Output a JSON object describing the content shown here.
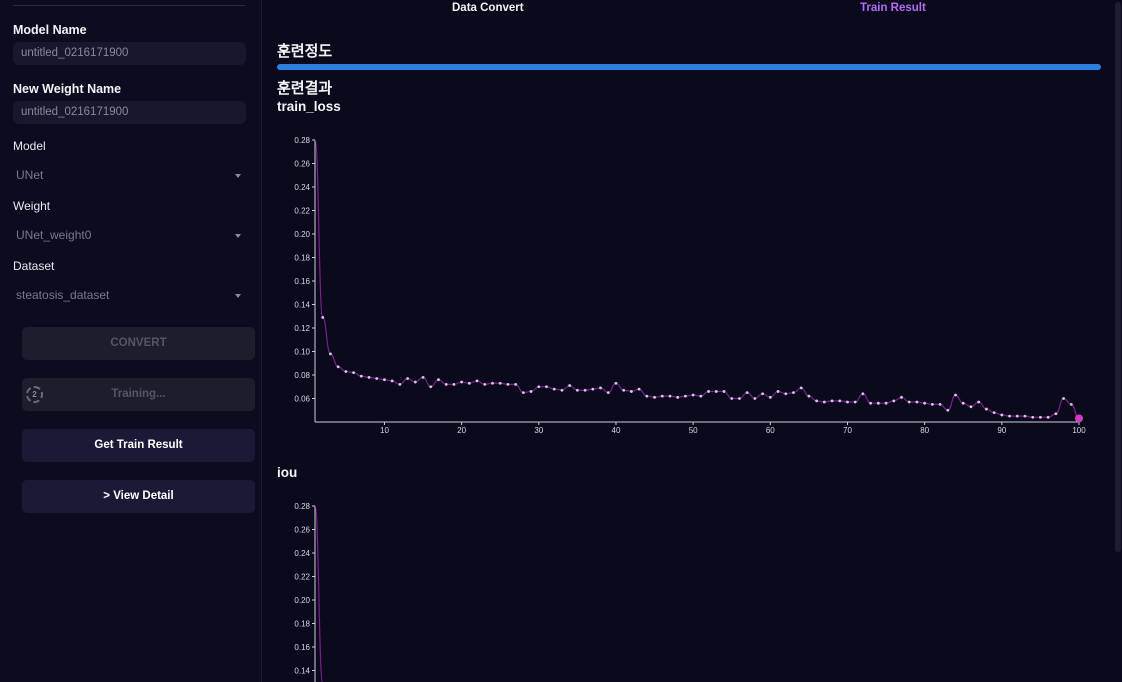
{
  "sidebar": {
    "model_name_label": "Model Name",
    "model_name_value": "untitled_0216171900",
    "weight_name_label": "New Weight Name",
    "weight_name_value": "untitled_0216171900",
    "model_label": "Model",
    "model_value": "UNet",
    "weight_label": "Weight",
    "weight_value": "UNet_weight0",
    "dataset_label": "Dataset",
    "dataset_value": "steatosis_dataset",
    "convert_button": "CONVERT",
    "training_button": "Training...",
    "spinner_text": "2",
    "train_result_button": "Get Train Result",
    "view_detail_button": "> View Detail"
  },
  "tabs": {
    "data_convert": "Data Convert",
    "train_result": "Train Result"
  },
  "main": {
    "progress_title": "훈련정도",
    "progress_value": 1.0,
    "result_title": "훈련결과"
  },
  "colors": {
    "accent": "#b46cf5",
    "progress": "#2f7fe0",
    "line": "#7a1f8e",
    "point": "#d9c6e6",
    "highlight": "#d03cc8"
  },
  "chart_data": [
    {
      "type": "line",
      "title": "train_loss",
      "ylim": [
        0.04,
        0.28
      ],
      "yticks": [
        0.06,
        0.08,
        0.1,
        0.12,
        0.14,
        0.16,
        0.18,
        0.2,
        0.22,
        0.24,
        0.26,
        0.28
      ],
      "xlim": [
        1,
        100
      ],
      "xticks": [
        10,
        20,
        30,
        40,
        50,
        60,
        70,
        80,
        90,
        100
      ],
      "x": [
        1,
        2,
        3,
        4,
        5,
        6,
        7,
        8,
        9,
        10,
        11,
        12,
        13,
        14,
        15,
        16,
        17,
        18,
        19,
        20,
        21,
        22,
        23,
        24,
        25,
        26,
        27,
        28,
        29,
        30,
        31,
        32,
        33,
        34,
        35,
        36,
        37,
        38,
        39,
        40,
        41,
        42,
        43,
        44,
        45,
        46,
        47,
        48,
        49,
        50,
        51,
        52,
        53,
        54,
        55,
        56,
        57,
        58,
        59,
        60,
        61,
        62,
        63,
        64,
        65,
        66,
        67,
        68,
        69,
        70,
        71,
        72,
        73,
        74,
        75,
        76,
        77,
        78,
        79,
        80,
        81,
        82,
        83,
        84,
        85,
        86,
        87,
        88,
        89,
        90,
        91,
        92,
        93,
        94,
        95,
        96,
        97,
        98,
        99,
        100
      ],
      "values": [
        0.28,
        0.129,
        0.098,
        0.087,
        0.083,
        0.082,
        0.079,
        0.078,
        0.077,
        0.076,
        0.075,
        0.072,
        0.077,
        0.074,
        0.078,
        0.07,
        0.076,
        0.072,
        0.072,
        0.074,
        0.073,
        0.075,
        0.072,
        0.073,
        0.073,
        0.072,
        0.072,
        0.065,
        0.066,
        0.07,
        0.07,
        0.068,
        0.067,
        0.071,
        0.067,
        0.067,
        0.068,
        0.069,
        0.065,
        0.073,
        0.067,
        0.066,
        0.068,
        0.062,
        0.061,
        0.062,
        0.062,
        0.061,
        0.062,
        0.063,
        0.062,
        0.066,
        0.066,
        0.066,
        0.06,
        0.06,
        0.065,
        0.06,
        0.064,
        0.061,
        0.066,
        0.064,
        0.065,
        0.069,
        0.062,
        0.058,
        0.057,
        0.058,
        0.058,
        0.057,
        0.057,
        0.064,
        0.056,
        0.056,
        0.056,
        0.058,
        0.061,
        0.057,
        0.057,
        0.056,
        0.055,
        0.055,
        0.05,
        0.063,
        0.056,
        0.053,
        0.057,
        0.051,
        0.048,
        0.046,
        0.045,
        0.045,
        0.045,
        0.044,
        0.044,
        0.044,
        0.047,
        0.06,
        0.055,
        0.043
      ]
    },
    {
      "type": "line",
      "title": "iou",
      "ylim": [
        0.04,
        0.28
      ],
      "yticks": [
        0.14,
        0.16,
        0.18,
        0.2,
        0.22,
        0.24,
        0.26,
        0.28
      ],
      "x": [
        1,
        2
      ],
      "values": [
        0.28,
        0.129
      ]
    }
  ]
}
